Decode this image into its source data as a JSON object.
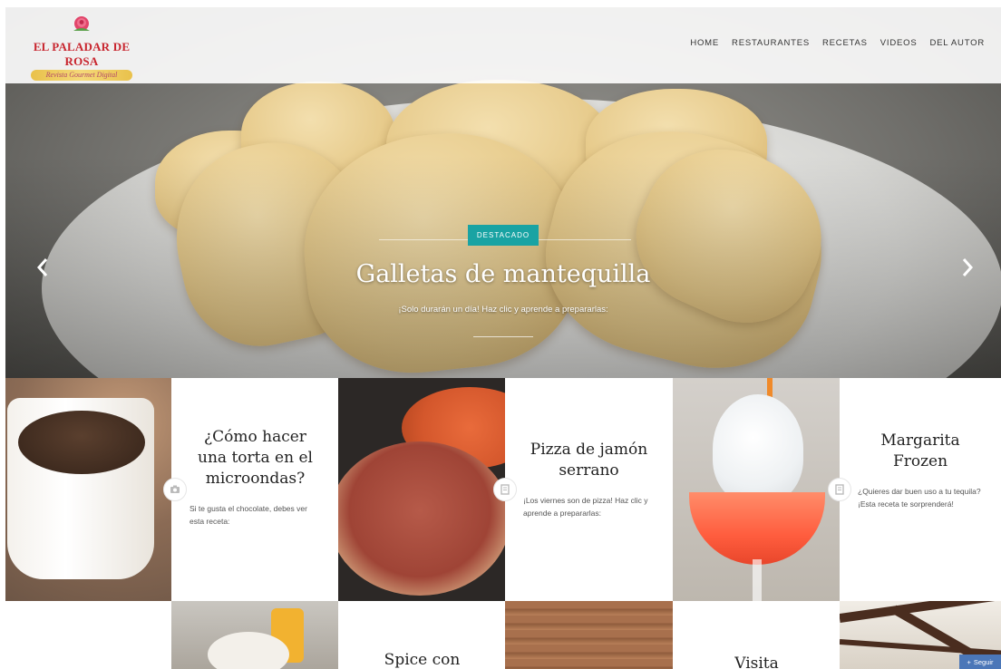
{
  "brand": {
    "name": "EL PALADAR DE ROSA",
    "tagline": "Revista Gourmet Digital",
    "colors": {
      "primary": "#c8252e",
      "accent": "#19a3a3"
    }
  },
  "nav": {
    "items": [
      "HOME",
      "RESTAURANTES",
      "RECETAS",
      "VIDEOS",
      "DEL AUTOR"
    ]
  },
  "hero": {
    "badge": "DESTACADO",
    "title": "Galletas de mantequilla",
    "subtitle": "¡Solo durarán un día! Haz clic y aprende a prepararlas:",
    "prev_icon": "chevron-left-icon",
    "next_icon": "chevron-right-icon"
  },
  "posts": [
    {
      "title": "¿Cómo hacer una torta en el microondas?",
      "excerpt": "Si te gusta el chocolate, debes ver esta receta:",
      "icon": "camera-icon"
    },
    {
      "title": "Pizza de jamón serrano",
      "excerpt": "¡Los viernes son de pizza! Haz clic y aprende a prepararlas:",
      "icon": "document-icon"
    },
    {
      "title": "Margarita Frozen",
      "excerpt": "¿Quieres dar buen uso a tu tequila? ¡Esta receta te sorprenderá!",
      "icon": "document-icon"
    }
  ],
  "row2": {
    "titles": [
      "Spice con",
      "Visita"
    ]
  },
  "follow_button": "Seguir"
}
